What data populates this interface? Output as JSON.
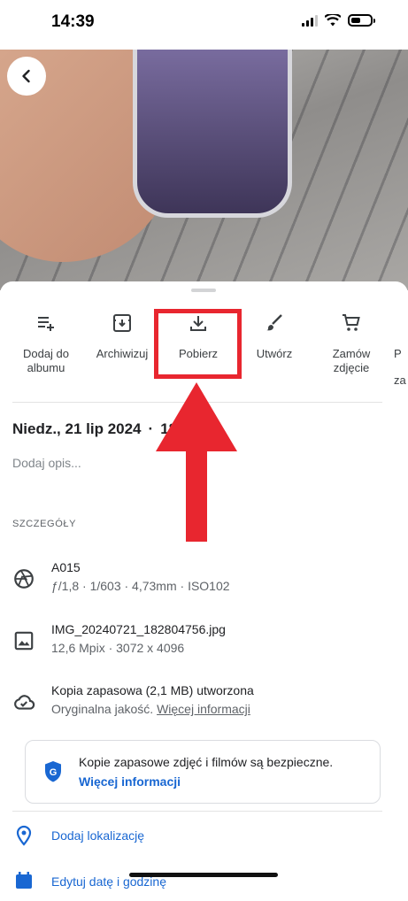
{
  "status_bar": {
    "time": "14:39"
  },
  "photo": {
    "alt_icon": "arrow-back-icon"
  },
  "actions": [
    {
      "label": "Dodaj do albumu",
      "icon": "playlist-add-icon"
    },
    {
      "label": "Archiwizuj",
      "icon": "archive-icon"
    },
    {
      "label": "Pobierz",
      "icon": "download-icon"
    },
    {
      "label": "Utwórz",
      "icon": "brush-icon"
    },
    {
      "label": "Zamów zdjęcie",
      "icon": "cart-icon"
    },
    {
      "label": "P",
      "label2": "za"
    }
  ],
  "info": {
    "date": "Niedz., 21 lip 2024",
    "time_partial": "18",
    "description_placeholder": "Dodaj opis..."
  },
  "details": {
    "section_title": "SZCZEGÓŁY",
    "camera": {
      "model": "A015",
      "specs": "ƒ/1,8  ·  1/603  ·  4,73mm  ·  ISO102"
    },
    "file": {
      "name": "IMG_20240721_182804756.jpg",
      "specs": "12,6 Mpix  ·  3072 x 4096"
    },
    "backup": {
      "title": "Kopia zapasowa (2,1 MB) utworzona",
      "quality": "Oryginalna jakość.",
      "link": "Więcej informacji"
    }
  },
  "safety_card": {
    "text": "Kopie zapasowe zdjęć i filmów są bezpieczne.",
    "link": "Więcej informacji"
  },
  "location": {
    "label": "Dodaj lokalizację"
  },
  "edit_datetime": {
    "label": "Edytuj datę i godzinę"
  },
  "colors": {
    "accent": "#1967d2",
    "annotation": "#e8262f"
  }
}
